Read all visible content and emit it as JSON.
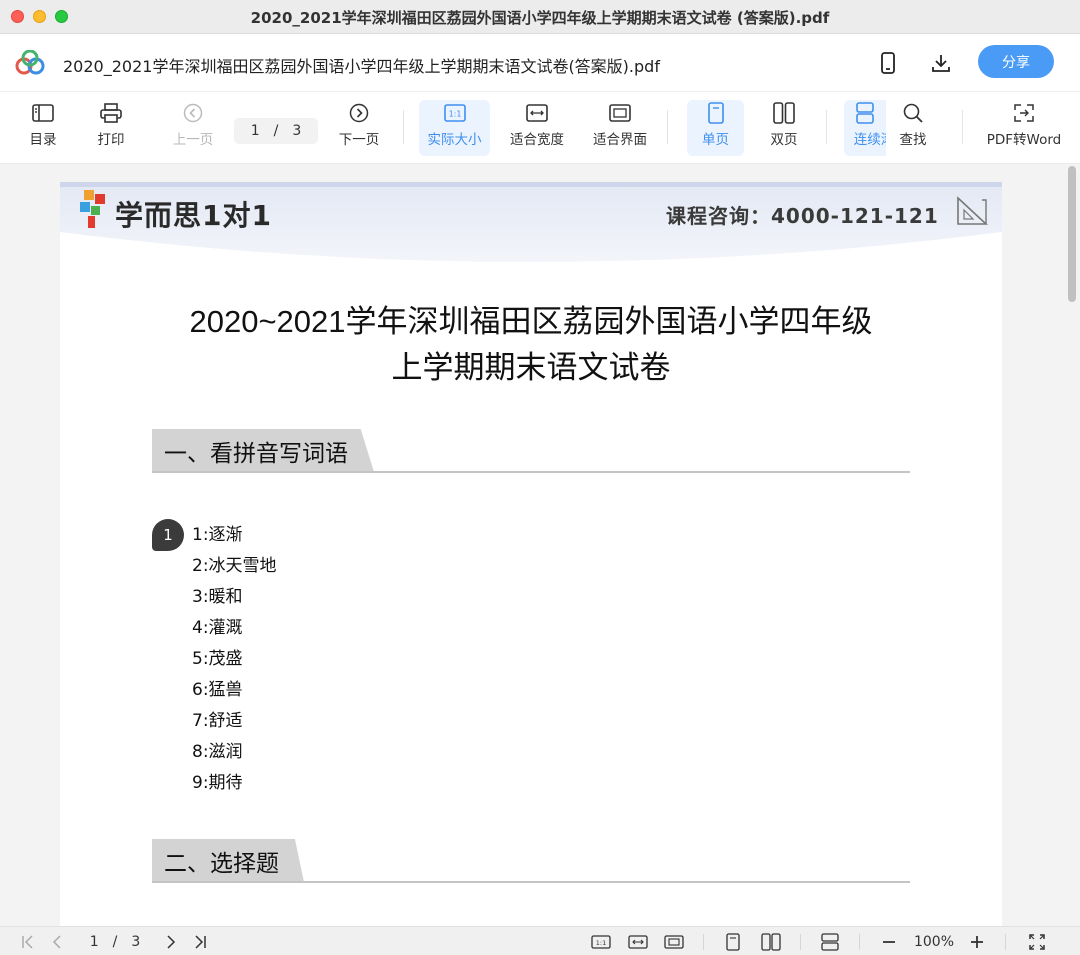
{
  "window": {
    "title": "2020_2021学年深圳福田区荔园外国语小学四年级上学期期末语文试卷 (答案版).pdf"
  },
  "header": {
    "doc_title": "2020_2021学年深圳福田区荔园外国语小学四年级上学期期末语文试卷(答案版).pdf",
    "share_label": "分享",
    "icons": [
      "app-logo-icon",
      "phone-icon",
      "download-icon"
    ]
  },
  "toolbar": {
    "toc": "目录",
    "print": "打印",
    "prev": "上一页",
    "current_page": "1",
    "page_sep": "/",
    "total_pages": "3",
    "next": "下一页",
    "actual_size": "实际大小",
    "fit_width": "适合宽度",
    "fit_page": "适合界面",
    "single_page": "单页",
    "two_page": "双页",
    "continuous": "连续滚",
    "find": "查找",
    "pdf_to_word": "PDF转Word",
    "accent_color": "#3f8ff0"
  },
  "document": {
    "brand": "学而思1对1",
    "hotline": "课程咨询：4000-121-121",
    "title_line1": "2020~2021学年深圳福田区荔园外国语小学四年级",
    "title_line2": "上学期期末语文试卷",
    "section1": "一、看拼音写词语",
    "question_number": "1",
    "answers": [
      "1:逐渐",
      "2:冰天雪地",
      "3:暖和",
      "4:灌溉",
      "5:茂盛",
      "6:猛兽",
      "7:舒适",
      "8:滋润",
      "9:期待"
    ],
    "section2": "二、选择题"
  },
  "statusbar": {
    "current_page": "1",
    "page_sep": "/",
    "total_pages": "3",
    "zoom": "100%"
  }
}
